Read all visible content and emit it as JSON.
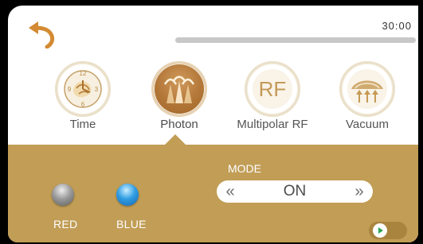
{
  "timer": {
    "time_left": "30:00",
    "progress_fraction": 0.0
  },
  "tabs": [
    {
      "id": "time",
      "label": "Time",
      "icon": "clock-icon",
      "active": false
    },
    {
      "id": "photon",
      "label": "Photon",
      "icon": "photon-icon",
      "active": true
    },
    {
      "id": "multipolar_rf",
      "label": "Multipolar RF",
      "icon": "rf-icon",
      "icon_text": "RF",
      "active": false
    },
    {
      "id": "vacuum",
      "label": "Vacuum",
      "icon": "vacuum-icon",
      "active": false
    }
  ],
  "photon_controls": {
    "lights": [
      {
        "id": "red",
        "label": "RED",
        "active": false
      },
      {
        "id": "blue",
        "label": "BLUE",
        "active": true
      }
    ],
    "mode": {
      "title": "MODE",
      "value": "ON",
      "prev_symbol": "«",
      "next_symbol": "»"
    },
    "play_toggle": {
      "state": "off",
      "icon": "play-icon"
    }
  },
  "colors": {
    "accent_gold": "#c19d56",
    "tab_active_brown": "#b27637",
    "background": "#ffffff",
    "progress_track": "#c8c8c8",
    "back_arrow": "#d38a32"
  }
}
